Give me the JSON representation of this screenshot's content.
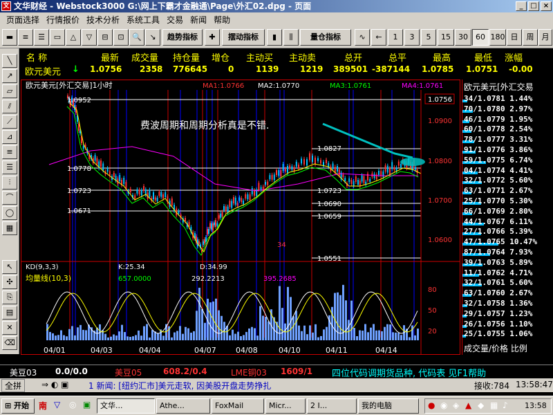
{
  "window": {
    "title": "文华财经 - Webstock3000    G:\\网上下霸才金融通\\Page\\外汇02.dpg - 页面"
  },
  "menu": [
    "页面选择",
    "行情报价",
    "技术分析",
    "系统工具",
    "交易",
    "新闻",
    "帮助"
  ],
  "toolbar": {
    "trend_label": "趋势指标",
    "swing_label": "摆动指标",
    "volume_label": "量仓指标",
    "periods": [
      "1",
      "3",
      "5",
      "15",
      "30",
      "60",
      "180",
      "日",
      "周",
      "月"
    ],
    "selected_period": "60"
  },
  "quote": {
    "headers": [
      "名  称",
      "最新",
      "成交量",
      "持仓量",
      "增仓",
      "主动买",
      "主动卖",
      "总开",
      "总平",
      "最高",
      "最低",
      "涨幅"
    ],
    "row": [
      "欧元美元",
      "1.0756",
      "2358",
      "776645",
      "0",
      "1139",
      "1219",
      "389501",
      "-387144",
      "1.0785",
      "1.0751",
      "-0.00"
    ]
  },
  "chart": {
    "title": "欧元美元[外汇交易]1小时",
    "ma1": "MA1:1.0766",
    "ma2": "MA2:1.0770",
    "ma3": "MA3:1.0761",
    "ma4": "MA4:1.0761",
    "annotation": "费波周期和周期分析真是不错.",
    "current_price": "1.0756",
    "price_labels_left": [
      "1.0952",
      "1.0778",
      "1.0723",
      "1.0671"
    ],
    "price_labels_mid": [
      "1.0827",
      "1.0723",
      "1.0690",
      "1.0659",
      "1.0551"
    ],
    "axis_right": [
      "1.0900",
      "1.0800",
      "1.0700",
      "1.0600"
    ],
    "cycle_label": "34",
    "kd_title": "KD(9,3,3)",
    "kd_k": "K:25.34",
    "kd_d": "D:34.99",
    "vol_title": "均量线(10,3)",
    "vol_values": [
      "657.0000",
      "292.2213",
      "395.2685"
    ],
    "osc_axis": [
      "80",
      "50",
      "20"
    ],
    "dates": [
      "04/01",
      "04/03",
      "04/04",
      "04/07",
      "04/08",
      "04/10",
      "04/11",
      "04/14"
    ]
  },
  "right_panel": {
    "title": "欧元美元[外汇交易",
    "rows": [
      "34/1.0781 1.44%",
      "70/1.0780 2.97%",
      "46/1.0779 1.95%",
      "60/1.0778 2.54%",
      "78/1.0777 3.31%",
      "91/1.0776 3.86%",
      "59/1.0775 6.74%",
      "04/1.0774 4.41%",
      "32/1.0772 5.60%",
      "63/1.0771 2.67%",
      "25/1.0770 5.30%",
      "66/1.0769 2.80%",
      "44/1.0767 6.11%",
      "27/1.0766 5.39%",
      "47/1.0765 10.47%",
      "87/1.0764 7.93%",
      "39/1.0763 5.89%",
      "11/1.0762 4.71%",
      "32/1.0761 5.60%",
      "63/1.0760 2.67%",
      "32/1.0758 1.36%",
      "29/1.0757 1.23%",
      "26/1.0756 1.10%",
      "25/1.0755 1.06%"
    ],
    "footer": "成交量/价格 比例"
  },
  "status": {
    "item1_name": "美豆03",
    "item1_val": "0.0/0.0",
    "item2_name": "美豆05",
    "item2_val": "608.2/0.4",
    "item3_name": "LME铜03",
    "item3_val": "1609/1",
    "message": "四位代码调期货品种, 代码表 见F1帮助",
    "mode_label": "全拼",
    "news": "1 新闻: [纽约汇市]美元走软, 因美股开盘走势挣扎",
    "recv": "接收:784",
    "time": "13:58:47"
  },
  "taskbar": {
    "start": "开始",
    "tasks": [
      "文华...",
      "Athe...",
      "FoxMail",
      "Micr...",
      "2 I...",
      "我的电脑"
    ],
    "clock": "13:58"
  },
  "colors": {
    "bull": "#ff3333",
    "bear": "#00c0ff",
    "ma_green": "#00ff00",
    "ma_magenta": "#ff00ff",
    "annotation": "#00c0c0"
  }
}
